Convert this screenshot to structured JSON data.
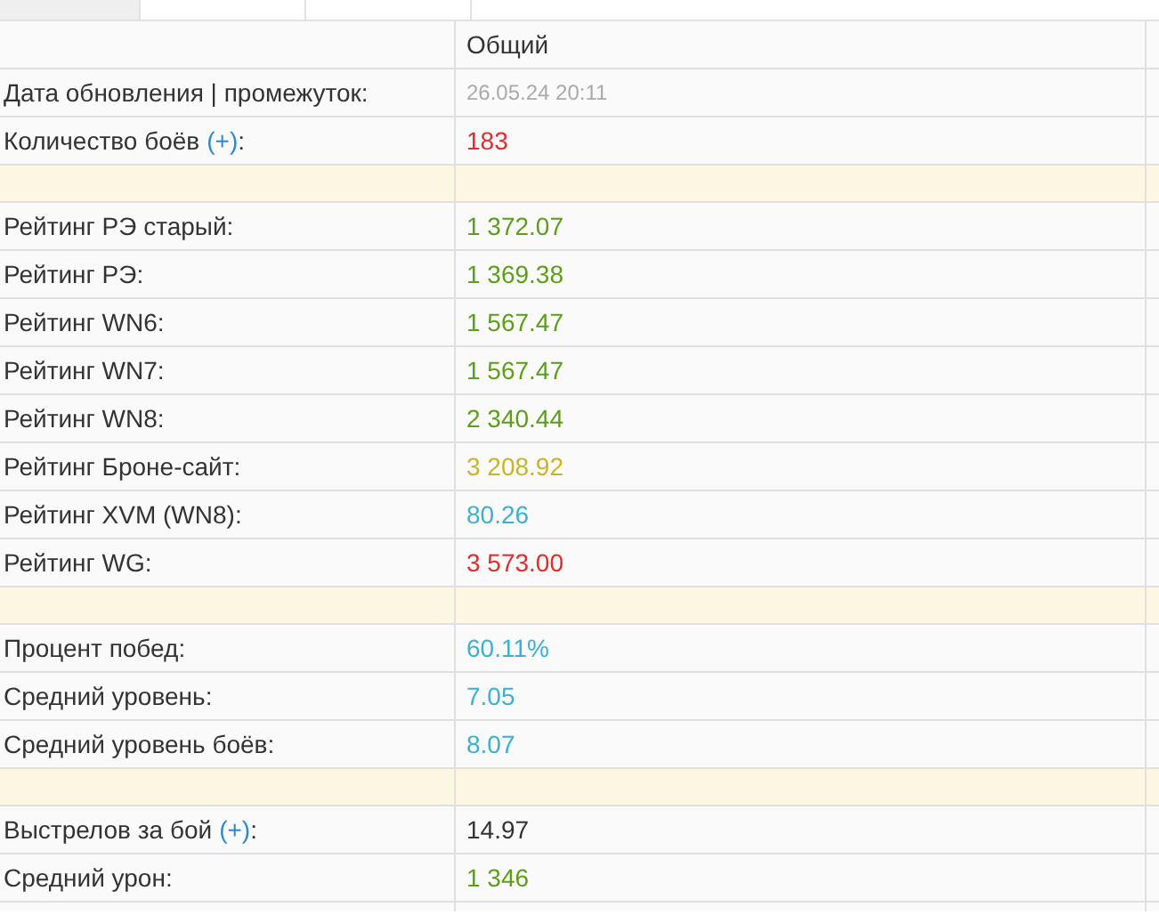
{
  "tabs": [
    {
      "selected": true
    },
    {
      "selected": false
    },
    {
      "selected": false
    }
  ],
  "table": {
    "columns": [
      "Общий"
    ],
    "rows": [
      {
        "kind": "data",
        "label": "Дата обновления | промежуток:",
        "value": "26.05.24 20:11",
        "color": "#aaaaaa",
        "small": true
      },
      {
        "kind": "data",
        "label": "Количество боёв",
        "link": "(+)",
        "tail": ":",
        "value": "183",
        "color": "#e8282a"
      },
      {
        "kind": "separator"
      },
      {
        "kind": "data",
        "label": "Рейтинг РЭ старый:",
        "value": "1 372.07",
        "color": "#5a9e1a"
      },
      {
        "kind": "data",
        "label": "Рейтинг РЭ:",
        "value": "1 369.38",
        "color": "#5a9e1a"
      },
      {
        "kind": "data",
        "label": "Рейтинг WN6:",
        "value": "1 567.47",
        "color": "#5a9e1a"
      },
      {
        "kind": "data",
        "label": "Рейтинг WN7:",
        "value": "1 567.47",
        "color": "#5a9e1a"
      },
      {
        "kind": "data",
        "label": "Рейтинг WN8:",
        "value": "2 340.44",
        "color": "#5a9e1a"
      },
      {
        "kind": "data",
        "label": "Рейтинг Броне-сайт:",
        "value": "3 208.92",
        "color": "#c8b42a"
      },
      {
        "kind": "data",
        "label": "Рейтинг XVM (WN8):",
        "value": "80.26",
        "color": "#3bb0d0"
      },
      {
        "kind": "data",
        "label": "Рейтинг WG:",
        "value": "3 573.00",
        "color": "#e8282a"
      },
      {
        "kind": "separator"
      },
      {
        "kind": "data",
        "label": "Процент побед:",
        "value": "60.11%",
        "color": "#3bb0d0"
      },
      {
        "kind": "data",
        "label": "Средний уровень:",
        "value": "7.05",
        "color": "#3bb0d0"
      },
      {
        "kind": "data",
        "label": "Средний уровень боёв:",
        "value": "8.07",
        "color": "#3bb0d0"
      },
      {
        "kind": "separator"
      },
      {
        "kind": "data",
        "label": "Выстрелов за бой",
        "link": "(+)",
        "tail": ":",
        "value": "14.97",
        "color": "#333333"
      },
      {
        "kind": "data",
        "label": "Средний урон:",
        "value": "1 346",
        "color": "#5a9e1a"
      }
    ]
  }
}
